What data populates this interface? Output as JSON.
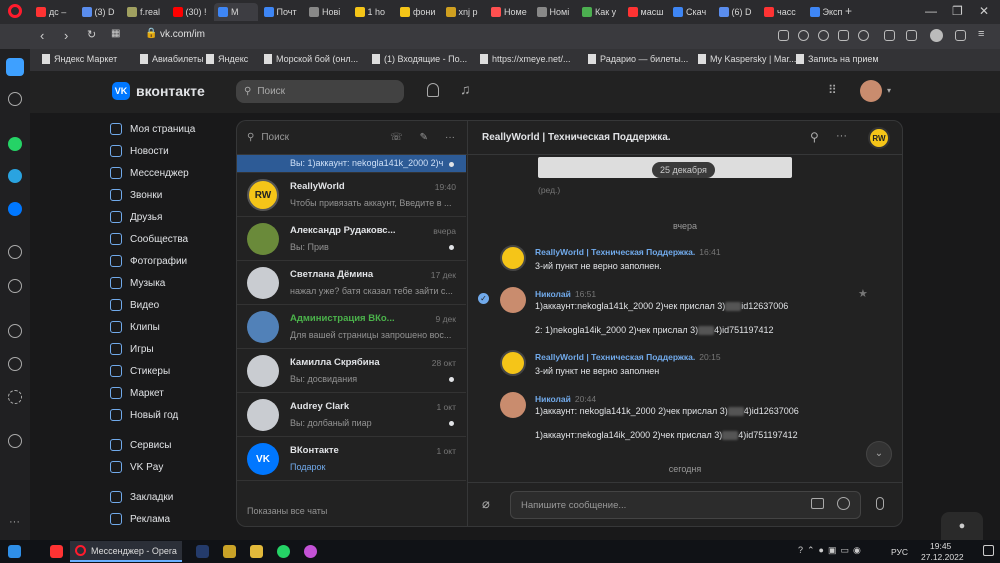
{
  "browser": {
    "tabs": [
      "дс –",
      "(3) D",
      "f.real",
      "(30) !",
      "M",
      "Почт",
      "Нові",
      "1 ho",
      "фони",
      "xnj p",
      "Номе",
      "Номі",
      "Как у",
      "масш",
      "Скач",
      "(6) D",
      "часс",
      "Эксп"
    ],
    "url": "vk.com/im",
    "bookmarks": [
      "Яндекс Маркет",
      "Авиабилеты",
      "Яндекс",
      "Морской бой (онл...",
      "(1) Входящие - По...",
      "https://xmeye.net/...",
      "Радарио — билеты...",
      "My Kaspersky | Mar...",
      "Запись на прием"
    ]
  },
  "vk": {
    "logo": "вконтакте",
    "search_placeholder": "Поиск",
    "nav": [
      "Моя страница",
      "Новости",
      "Мессенджер",
      "Звонки",
      "Друзья",
      "Сообщества",
      "Фотографии",
      "Музыка",
      "Видео",
      "Клипы",
      "Игры",
      "Стикеры",
      "Маркет",
      "Новый год"
    ],
    "nav2": [
      "Сервисы",
      "VK Pay"
    ],
    "nav3": [
      "Закладки",
      "Реклама"
    ]
  },
  "chatlist": {
    "search_placeholder": "Поиск",
    "first_preview": "Вы: 1)аккаунт: nekogla141k_2000 2)ч",
    "footer": "Показаны все чаты",
    "rows": [
      {
        "name": "ReallyWorld",
        "time": "19:40",
        "preview": "Чтобы привязать аккаунт, Введите в ..."
      },
      {
        "name": "Александр Рудаковс...",
        "time": "вчера",
        "preview": "Вы: Прив"
      },
      {
        "name": "Светлана Дёмина",
        "time": "17 дек",
        "preview": "нажал уже? батя сказал тебе зайти с..."
      },
      {
        "name": "Администрация ВКо...",
        "time": "9 дек",
        "preview": "Для вашей страницы запрошено вос..."
      },
      {
        "name": "Камилла Скрябина",
        "time": "28 окт",
        "preview": "Вы: досвидания"
      },
      {
        "name": "Audrey Clark",
        "time": "1 окт",
        "preview": "Вы: долбаный пиар"
      },
      {
        "name": "ВКонтакте",
        "time": "1 окт",
        "preview": "Подарок"
      }
    ]
  },
  "chat": {
    "title": "ReallyWorld | Техническая Поддержка.",
    "date_pill": "25 декабря",
    "edited": "(ред.)",
    "sep_yesterday": "вчера",
    "sep_today": "сегодня",
    "input_placeholder": "Напишите сообщение...",
    "messages": [
      {
        "name": "ReallyWorld | Техническая Поддержка.",
        "time": "16:41",
        "lines": [
          "3-ий пункт не верно заполнен."
        ]
      },
      {
        "name": "Николай",
        "time": "16:51",
        "lines": [
          "1)аккаунт:nekogla141k_2000 2)чек прислал 3)",
          "id12637006",
          "2: 1)nekogla14ik_2000 2)чек прислал 3)",
          "4)id751197412"
        ]
      },
      {
        "name": "ReallyWorld | Техническая Поддержка.",
        "time": "20:15",
        "lines": [
          "3-ий пункт не верно заполнен"
        ]
      },
      {
        "name": "Николай",
        "time": "20:44",
        "lines": [
          "1)аккаунт: nekogla141k_2000 2)чек прислал 3)",
          "4)id12637006",
          "1)аккаунт:nekogla14ik_2000 2)чек прислал 3)",
          "4)id751197412"
        ]
      }
    ]
  },
  "taskbar": {
    "app": "Мессенджер - Opera",
    "time": "19:45",
    "date": "27.12.2022",
    "lang": "РУС"
  }
}
